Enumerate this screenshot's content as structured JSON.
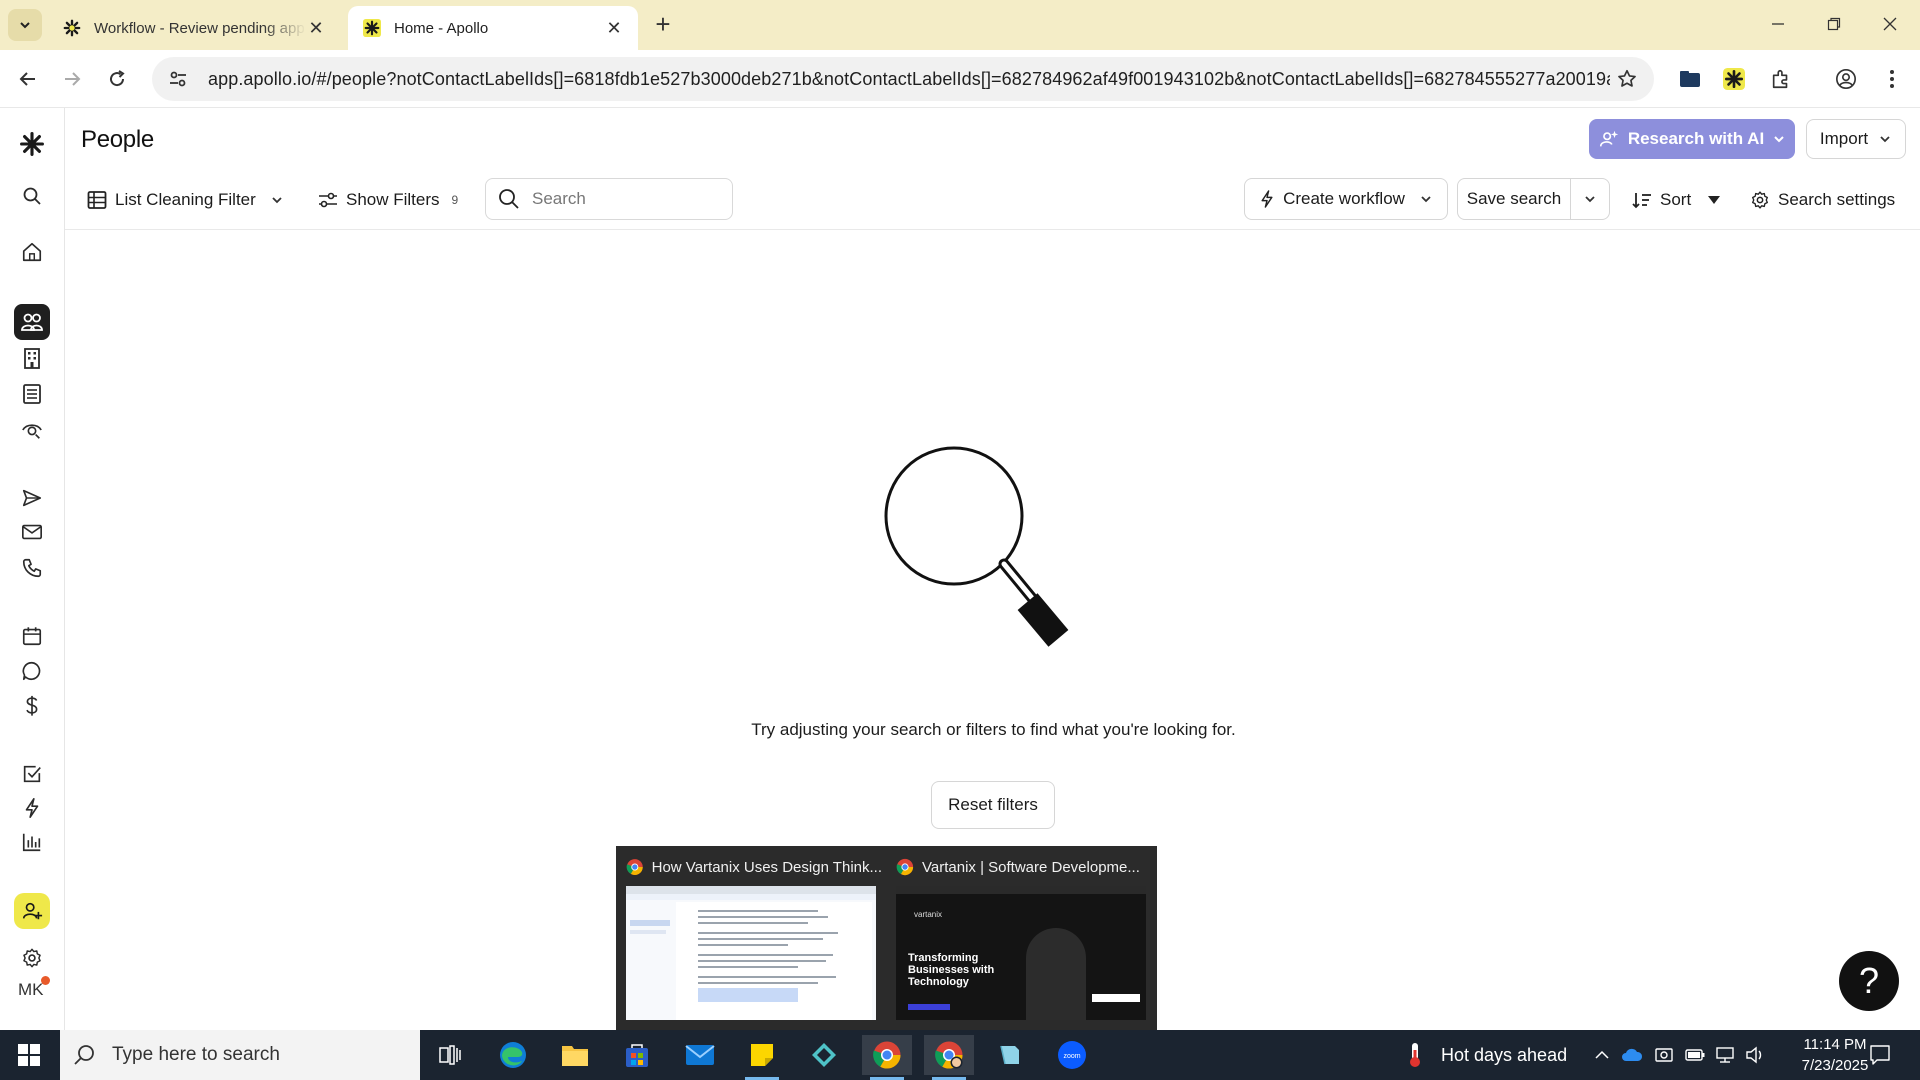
{
  "browser": {
    "tabs": [
      {
        "title": "Workflow - Review pending app",
        "active": false
      },
      {
        "title": "Home - Apollo",
        "active": true
      }
    ],
    "url": "app.apollo.io/#/people?notContactLabelIds[]=6818fdb1e527b3000deb271b&notContactLabelIds[]=682784962af49f001943102b&notContactLabelIds[]=682784555277a20019a3b6c..."
  },
  "app": {
    "page_title": "People",
    "research_ai_label": "Research with AI",
    "import_label": "Import",
    "toolbar": {
      "list_filter_label": "List Cleaning Filter",
      "show_filters_label": "Show Filters",
      "filter_count": "9",
      "search_placeholder": "Search",
      "create_workflow_label": "Create workflow",
      "save_search_label": "Save search",
      "sort_label": "Sort",
      "search_settings_label": "Search settings"
    },
    "empty_state": {
      "message": "Try adjusting your search or filters to find what you're looking for.",
      "reset_label": "Reset filters"
    },
    "avatar_initials": "MK",
    "help_label": "?"
  },
  "thumbnails": [
    {
      "title": "How Vartanix Uses Design Think..."
    },
    {
      "title": "Vartanix | Software Developme...",
      "headline": "Transforming Businesses with Technology",
      "brand": "vartanix"
    }
  ],
  "taskbar": {
    "search_placeholder": "Type here to search",
    "weather": "Hot days ahead",
    "time": "11:14 PM",
    "date": "7/23/2025"
  },
  "colors": {
    "chrome_tabbar": "#f4edc7",
    "apollo_yellow": "#efe84a",
    "ai_button": "#8d8fdc",
    "taskbar": "#1b2430"
  }
}
